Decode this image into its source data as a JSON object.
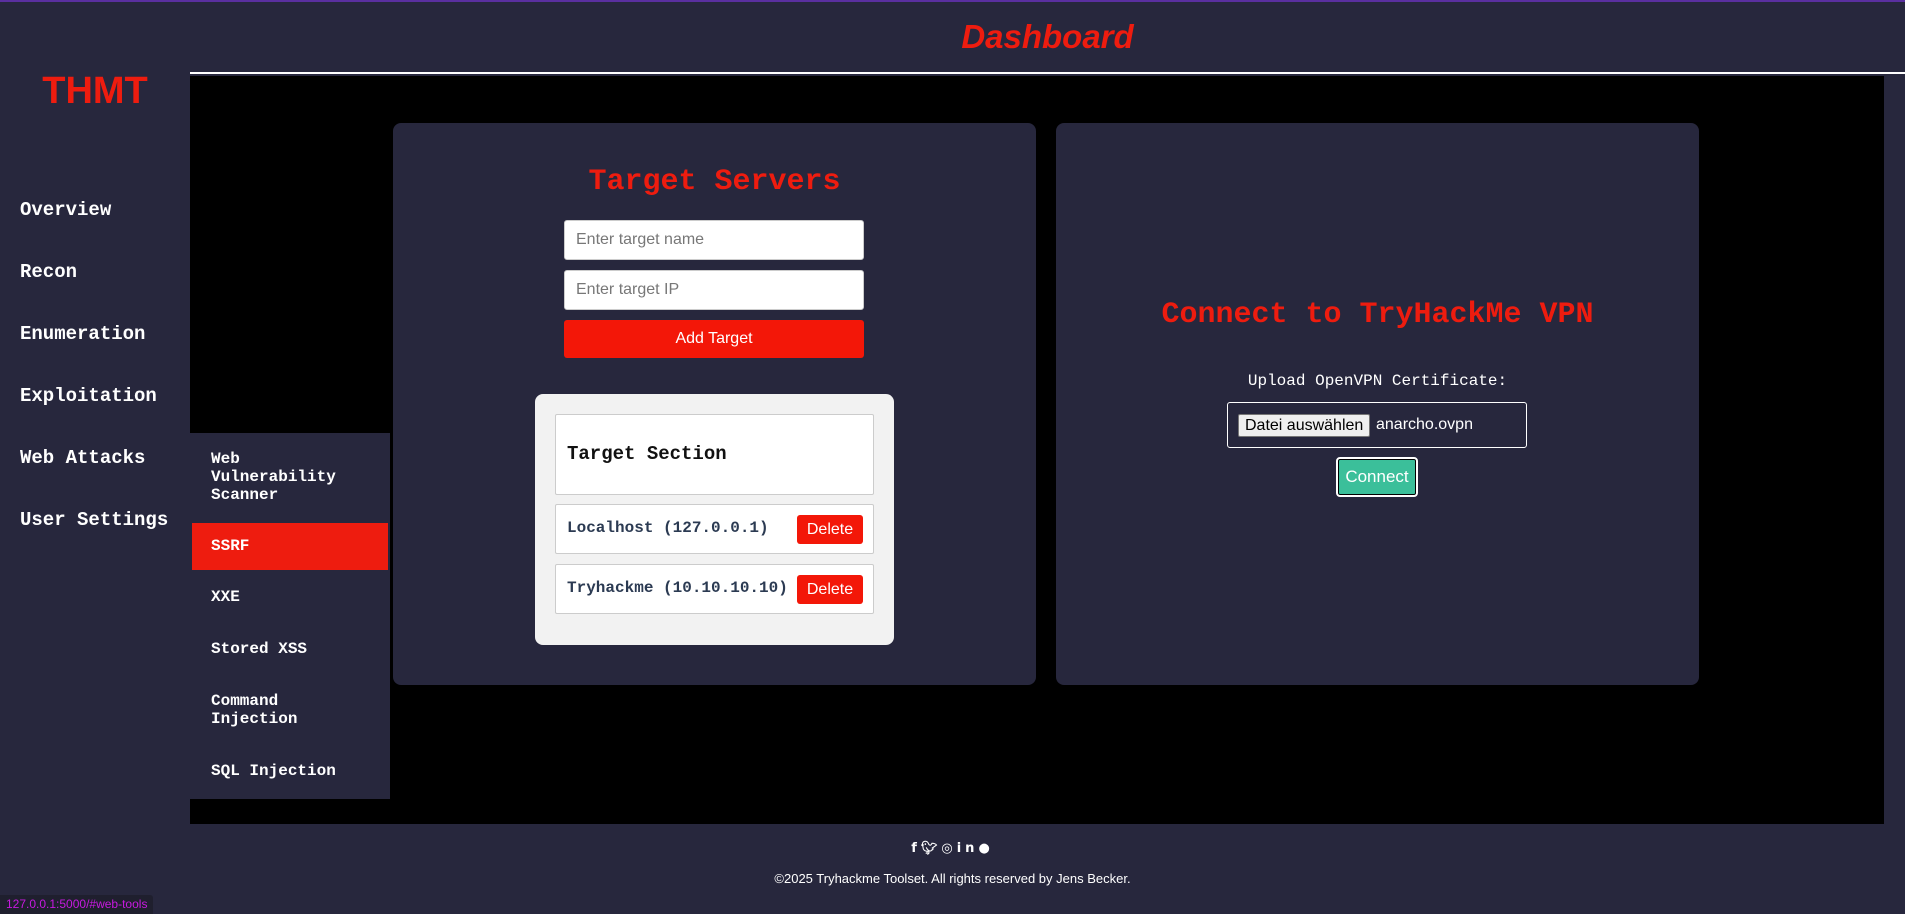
{
  "header": {
    "title": "Dashboard"
  },
  "brand": "THMT",
  "nav": {
    "items": [
      {
        "label": "Overview"
      },
      {
        "label": "Recon"
      },
      {
        "label": "Enumeration"
      },
      {
        "label": "Exploitation"
      },
      {
        "label": "Web Attacks"
      },
      {
        "label": "User Settings"
      }
    ]
  },
  "submenu": {
    "items": [
      {
        "label": "Web Vulnerability Scanner",
        "active": false
      },
      {
        "label": "SSRF",
        "active": true
      },
      {
        "label": "XXE",
        "active": false
      },
      {
        "label": "Stored XSS",
        "active": false
      },
      {
        "label": "Command Injection",
        "active": false
      },
      {
        "label": "SQL Injection",
        "active": false
      }
    ]
  },
  "targets": {
    "title": "Target Servers",
    "name_placeholder": "Enter target name",
    "ip_placeholder": "Enter target IP",
    "add_label": "Add Target",
    "section_title": "Target Section",
    "list": [
      {
        "name": "Localhost (127.0.0.1)",
        "delete_label": "Delete"
      },
      {
        "name": "Tryhackme (10.10.10.10)",
        "delete_label": "Delete"
      }
    ]
  },
  "vpn": {
    "title": "Connect to TryHackMe VPN",
    "upload_label": "Upload OpenVPN Certificate:",
    "file_button": "Datei auswählen",
    "file_name": "anarcho.ovpn",
    "connect_label": "Connect"
  },
  "footer": {
    "icons": [
      "facebook-icon",
      "twitter-icon",
      "instagram-icon",
      "linkedin-icon",
      "github-icon"
    ],
    "copyright": "©2025 Tryhackme Toolset. All rights reserved by Jens Becker."
  },
  "statusbar": {
    "url": "127.0.0.1:5000/#web-tools"
  },
  "colors": {
    "accent": "#ee1c0f",
    "panel": "#27273d",
    "connect": "#3bbf9a",
    "status": "#c71ae0"
  }
}
